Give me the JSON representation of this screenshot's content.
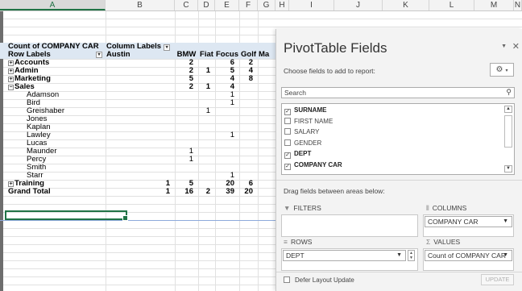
{
  "columns": [
    "A",
    "B",
    "C",
    "D",
    "E",
    "F",
    "G",
    "H",
    "I",
    "J",
    "K",
    "L",
    "M",
    "N"
  ],
  "pivot": {
    "value_header": "Count of COMPANY CAR",
    "column_labels": "Column Labels",
    "row_labels": "Row Labels",
    "column_items": [
      "Austin",
      "BMW",
      "Fiat",
      "Focus",
      "Golf",
      "Ma"
    ],
    "rows": [
      {
        "label": "Accounts",
        "type": "group",
        "collapsed": true,
        "values": [
          "",
          "2",
          "",
          "6",
          "2"
        ]
      },
      {
        "label": "Admin",
        "type": "group",
        "collapsed": true,
        "values": [
          "",
          "2",
          "1",
          "5",
          "4"
        ]
      },
      {
        "label": "Marketing",
        "type": "group",
        "collapsed": true,
        "values": [
          "",
          "5",
          "",
          "4",
          "8"
        ]
      },
      {
        "label": "Sales",
        "type": "group",
        "collapsed": false,
        "values": [
          "",
          "2",
          "1",
          "4",
          ""
        ]
      },
      {
        "label": "Adamson",
        "type": "child",
        "values": [
          "",
          "",
          "",
          "1",
          ""
        ]
      },
      {
        "label": "Bird",
        "type": "child",
        "values": [
          "",
          "",
          "",
          "1",
          ""
        ]
      },
      {
        "label": "Greishaber",
        "type": "child",
        "values": [
          "",
          "",
          "1",
          "",
          ""
        ]
      },
      {
        "label": "Jones",
        "type": "child",
        "values": [
          "",
          "",
          "",
          "",
          ""
        ]
      },
      {
        "label": "Kaplan",
        "type": "child",
        "values": [
          "",
          "",
          "",
          "",
          ""
        ]
      },
      {
        "label": "Lawley",
        "type": "child",
        "values": [
          "",
          "",
          "",
          "1",
          ""
        ]
      },
      {
        "label": "Lucas",
        "type": "child",
        "values": [
          "",
          "",
          "",
          "",
          ""
        ]
      },
      {
        "label": "Maunder",
        "type": "child",
        "values": [
          "",
          "1",
          "",
          "",
          ""
        ]
      },
      {
        "label": "Percy",
        "type": "child",
        "values": [
          "",
          "1",
          "",
          "",
          ""
        ]
      },
      {
        "label": "Smith",
        "type": "child",
        "values": [
          "",
          "",
          "",
          "",
          ""
        ]
      },
      {
        "label": "Starr",
        "type": "child",
        "values": [
          "",
          "",
          "",
          "1",
          ""
        ]
      },
      {
        "label": "Training",
        "type": "group",
        "collapsed": true,
        "values": [
          "1",
          "5",
          "",
          "20",
          "6"
        ]
      },
      {
        "label": "Grand Total",
        "type": "total",
        "values": [
          "1",
          "16",
          "2",
          "39",
          "20"
        ]
      }
    ]
  },
  "pane": {
    "title": "PivotTable Fields",
    "choose_label": "Choose fields to add to report:",
    "search_placeholder": "Search",
    "fields": [
      {
        "name": "SURNAME",
        "checked": true
      },
      {
        "name": "FIRST NAME",
        "checked": false
      },
      {
        "name": "SALARY",
        "checked": false
      },
      {
        "name": "GENDER",
        "checked": false
      },
      {
        "name": "DEPT",
        "checked": true
      },
      {
        "name": "COMPANY CAR",
        "checked": true
      }
    ],
    "drag_label": "Drag fields between areas below:",
    "areas": {
      "filters_label": "FILTERS",
      "columns_label": "COLUMNS",
      "rows_label": "ROWS",
      "values_label": "VALUES",
      "columns_item": "COMPANY CAR",
      "rows_item": "DEPT",
      "values_item": "Count of COMPANY CAR"
    },
    "defer_label": "Defer Layout Update",
    "update_label": "UPDATE"
  }
}
